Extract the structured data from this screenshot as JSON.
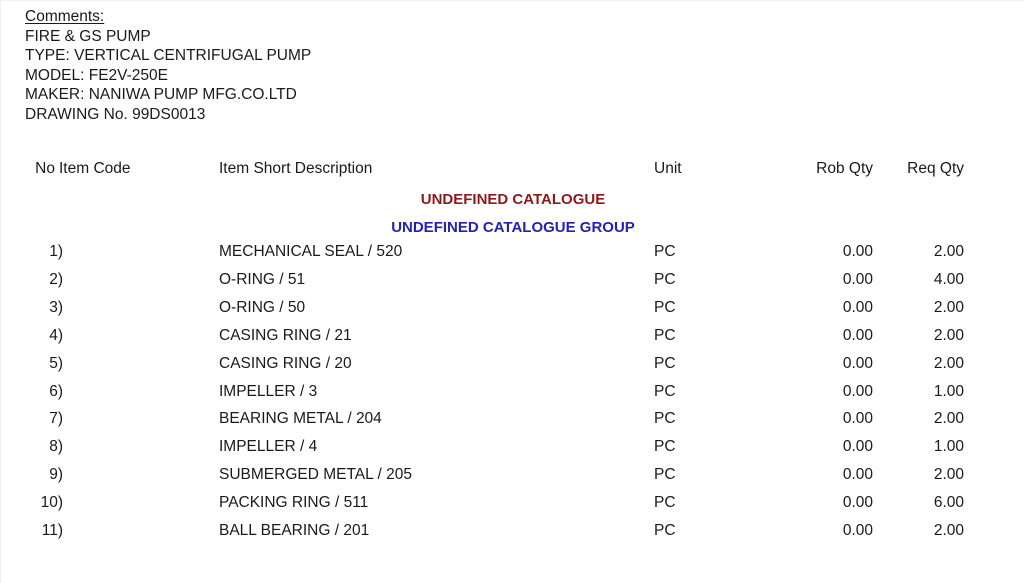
{
  "comments": {
    "title": "Comments:",
    "lines": [
      "FIRE & GS PUMP",
      "TYPE: VERTICAL CENTRIFUGAL PUMP",
      "MODEL: FE2V-250E",
      "MAKER: NANIWA PUMP MFG.CO.LTD",
      "DRAWING No. 99DS0013"
    ]
  },
  "table": {
    "headers": {
      "no": "No",
      "item_code": "Item Code",
      "description": "Item Short Description",
      "unit": "Unit",
      "rob_qty": "Rob Qty",
      "req_qty": "Req Qty"
    },
    "catalogue_heading": "UNDEFINED CATALOGUE",
    "catalogue_group_heading": "UNDEFINED CATALOGUE GROUP",
    "catalogue_heading_color": "#8b1a1a",
    "catalogue_group_heading_color": "#2222b4",
    "rows": [
      {
        "no": "1)",
        "item_code": "",
        "description": "MECHANICAL SEAL / 520",
        "unit": "PC",
        "rob_qty": "0.00",
        "req_qty": "2.00"
      },
      {
        "no": "2)",
        "item_code": "",
        "description": "O-RING / 51",
        "unit": "PC",
        "rob_qty": "0.00",
        "req_qty": "4.00"
      },
      {
        "no": "3)",
        "item_code": "",
        "description": "O-RING / 50",
        "unit": "PC",
        "rob_qty": "0.00",
        "req_qty": "2.00"
      },
      {
        "no": "4)",
        "item_code": "",
        "description": "CASING RING / 21",
        "unit": "PC",
        "rob_qty": "0.00",
        "req_qty": "2.00"
      },
      {
        "no": "5)",
        "item_code": "",
        "description": "CASING RING / 20",
        "unit": "PC",
        "rob_qty": "0.00",
        "req_qty": "2.00"
      },
      {
        "no": "6)",
        "item_code": "",
        "description": "IMPELLER / 3",
        "unit": "PC",
        "rob_qty": "0.00",
        "req_qty": "1.00"
      },
      {
        "no": "7)",
        "item_code": "",
        "description": "BEARING METAL / 204",
        "unit": "PC",
        "rob_qty": "0.00",
        "req_qty": "2.00"
      },
      {
        "no": "8)",
        "item_code": "",
        "description": "IMPELLER / 4",
        "unit": "PC",
        "rob_qty": "0.00",
        "req_qty": "1.00"
      },
      {
        "no": "9)",
        "item_code": "",
        "description": "SUBMERGED METAL / 205",
        "unit": "PC",
        "rob_qty": "0.00",
        "req_qty": "2.00"
      },
      {
        "no": "10)",
        "item_code": "",
        "description": "PACKING RING / 511",
        "unit": "PC",
        "rob_qty": "0.00",
        "req_qty": "6.00"
      },
      {
        "no": "11)",
        "item_code": "",
        "description": "BALL BEARING / 201",
        "unit": "PC",
        "rob_qty": "0.00",
        "req_qty": "2.00"
      }
    ]
  }
}
